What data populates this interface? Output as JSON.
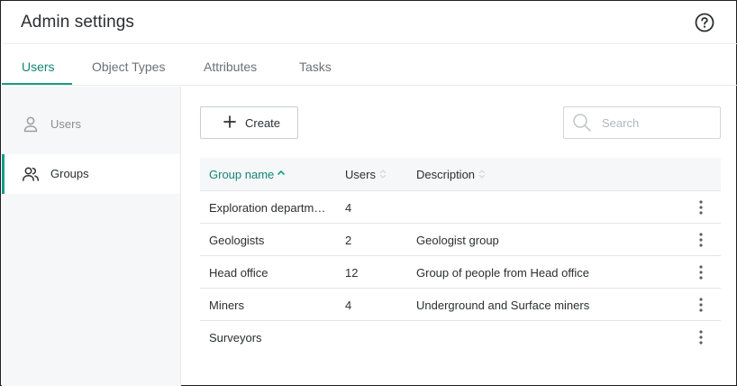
{
  "header": {
    "title": "Admin settings",
    "help_icon": "question-circle-icon"
  },
  "tabs": [
    {
      "label": "Users",
      "active": true
    },
    {
      "label": "Object Types",
      "active": false
    },
    {
      "label": "Attributes",
      "active": false
    },
    {
      "label": "Tasks",
      "active": false
    }
  ],
  "sidebar": {
    "items": [
      {
        "label": "Users",
        "icon": "user-icon",
        "active": false
      },
      {
        "label": "Groups",
        "icon": "users-icon",
        "active": true
      }
    ]
  },
  "toolbar": {
    "create_label": "Create",
    "create_icon": "plus-icon"
  },
  "search": {
    "placeholder": "Search",
    "value": "",
    "icon": "search-icon"
  },
  "table": {
    "columns": [
      {
        "label": "Group name",
        "sort": "ascending"
      },
      {
        "label": "Users",
        "sort": "none"
      },
      {
        "label": "Description",
        "sort": "none"
      }
    ],
    "rows": [
      {
        "name": "Exploration departme...",
        "users": "4",
        "description": ""
      },
      {
        "name": "Geologists",
        "users": "2",
        "description": "Geologist group"
      },
      {
        "name": "Head office",
        "users": "12",
        "description": "Group of people from Head office"
      },
      {
        "name": "Miners",
        "users": "4",
        "description": "Underground and Surface miners"
      },
      {
        "name": "Surveyors",
        "users": "",
        "description": ""
      }
    ],
    "row_menu_icon": "more-vertical-icon"
  },
  "colors": {
    "accent": "#1a9b8a",
    "accent_text": "#138577",
    "sidebar_bg": "#f6f7f8",
    "header_bg": "#f6f7f8"
  }
}
